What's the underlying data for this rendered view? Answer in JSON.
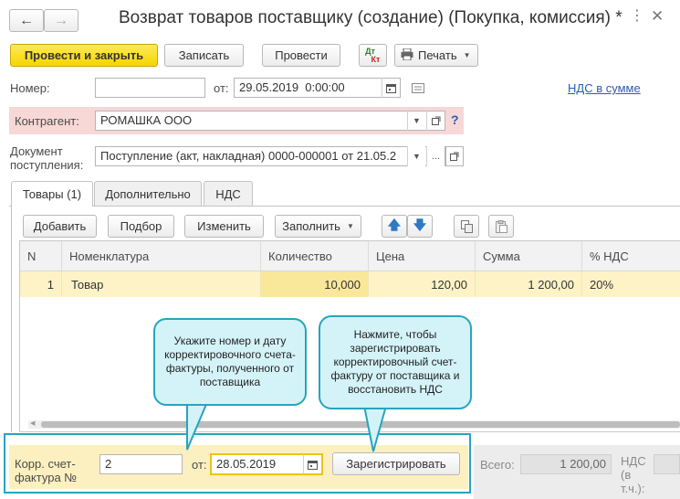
{
  "window": {
    "title": "Возврат товаров поставщику (создание) (Покупка, комиссия) *",
    "more_icon": "kebab-menu-icon",
    "close_icon": "close-icon"
  },
  "toolbar": {
    "post_and_close": "Провести и закрыть",
    "save": "Записать",
    "post": "Провести",
    "dt_kt_top": "Дт",
    "dt_kt_bottom": "Кт",
    "print": "Печать"
  },
  "header": {
    "number_label": "Номер:",
    "number_value": "",
    "date_from_label": "от:",
    "date_value": "29.05.2019  0:00:00",
    "vat_link": "НДС в сумме",
    "counterparty_label": "Контрагент:",
    "counterparty_value": "РОМАШКА ООО",
    "help": "?",
    "doc_label_line1": "Документ",
    "doc_label_line2": "поступления:",
    "doc_value": "Поступление (акт, накладная) 0000-000001 от 21.05.2",
    "ellipsis": "..."
  },
  "tabs": [
    {
      "label": "Товары (1)"
    },
    {
      "label": "Дополнительно"
    },
    {
      "label": "НДС"
    }
  ],
  "table_toolbar": {
    "add": "Добавить",
    "select": "Подбор",
    "edit": "Изменить",
    "fill": "Заполнить"
  },
  "table": {
    "columns": [
      "N",
      "Номенклатура",
      "Количество",
      "Цена",
      "Сумма",
      "% НДС"
    ],
    "rows": [
      {
        "n": "1",
        "item": "Товар",
        "qty": "10,000",
        "price": "120,00",
        "sum": "1 200,00",
        "vat": "20%"
      }
    ]
  },
  "callouts": {
    "left": "Укажите номер и дату корректировочного счета-фактуры, полученного от поставщика",
    "right": "Нажмите, чтобы зарегистрировать корректировочный счет-фактуру от поставщика и восстановить НДС"
  },
  "footer": {
    "corr_label_line1": "Корр. счет-",
    "corr_label_line2": "фактура №",
    "corr_number": "2",
    "corr_from_label": "от:",
    "corr_date": "28.05.2019",
    "register_button": "Зарегистрировать",
    "total_label": "Всего:",
    "total_value": "1 200,00",
    "vat_label_line1": "НДС",
    "vat_label_line2": "(в",
    "vat_label_line3": "т.ч.):"
  },
  "colors": {
    "accent_yellow": "#f5d500",
    "highlight_pink": "#f8d7d7",
    "callout_fill": "#d4f3f8",
    "callout_border": "#27a4be",
    "row_highlight": "#fdf3c6",
    "link_blue": "#2a5db0"
  }
}
